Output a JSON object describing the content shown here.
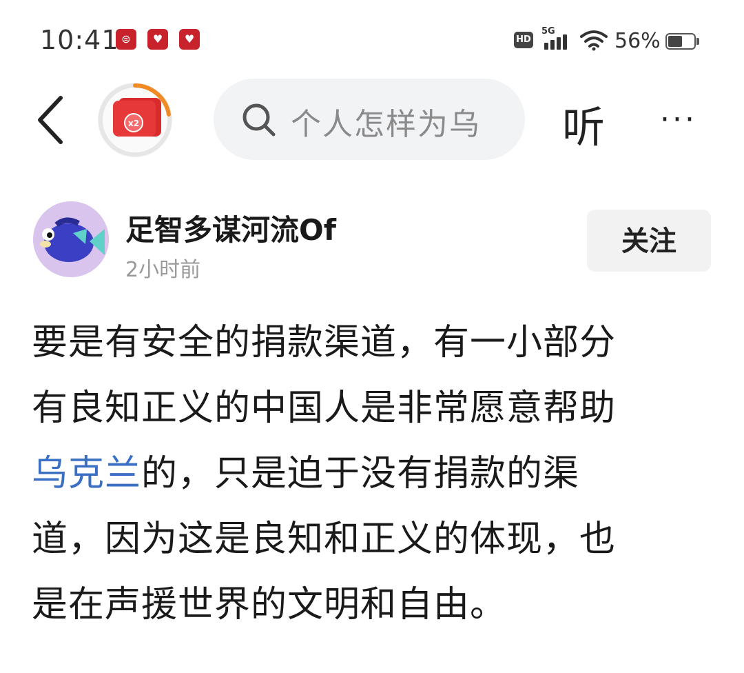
{
  "status_bar": {
    "time": "10:41",
    "network": "5G",
    "hd": "HD",
    "battery_text": "56%",
    "battery_level": 0.56,
    "notification_icons": [
      "bank-app-icon",
      "heart-app-icon",
      "618-app-icon"
    ]
  },
  "nav": {
    "search_placeholder": "个人怎样为乌",
    "listen_label": "听",
    "more_label": "···",
    "reward_badge": "x2"
  },
  "author": {
    "name": "足智多谋河流Of",
    "time": "2小时前",
    "follow_label": "关注"
  },
  "article": {
    "line1": "要是有安全的捐款渠道，有一小部分",
    "line2": "有良知正义的中国人是非常愿意帮助",
    "line3_link": "乌克兰",
    "line3_rest": "的，只是迫于没有捐款的渠",
    "line4": "道，因为这是良知和正义的体现，也",
    "line5": "是在声援世界的文明和自由。"
  },
  "colors": {
    "link": "#3a6fc4",
    "accent_red": "#e63838",
    "search_bg": "#f2f3f5"
  }
}
